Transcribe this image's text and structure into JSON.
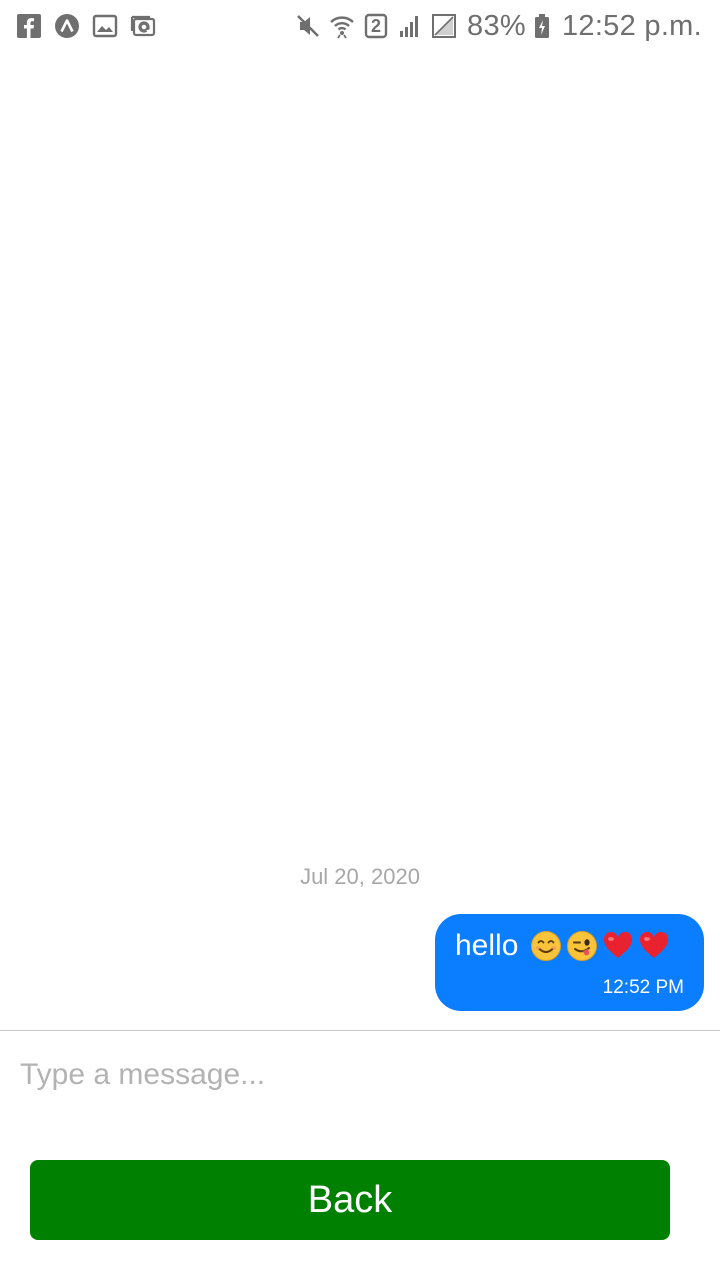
{
  "status_bar": {
    "left_icons": [
      "facebook-icon",
      "app-notification-icon",
      "image-icon",
      "email-icon"
    ],
    "right_icons": [
      "mute-icon",
      "wifi-icon",
      "sim-2-icon",
      "signal-icon",
      "no-sim-icon",
      "battery-charging-icon"
    ],
    "sim_number": "2",
    "battery_percent": "83%",
    "time": "12:52 p.m."
  },
  "chat": {
    "date_separator": "Jul 20, 2020",
    "messages": [
      {
        "text": "hello",
        "emojis": [
          "smiling-face-icon",
          "winking-face-tongue-icon",
          "red-heart-icon",
          "red-heart-icon"
        ],
        "time": "12:52 PM",
        "outgoing": true
      }
    ]
  },
  "composer": {
    "placeholder": "Type a message...",
    "value": ""
  },
  "back_button": {
    "label": "Back"
  },
  "colors": {
    "bubble": "#0a7eff",
    "back_button": "#008000",
    "status_text": "#6f6f6f",
    "date_text": "#a7a7a7"
  }
}
